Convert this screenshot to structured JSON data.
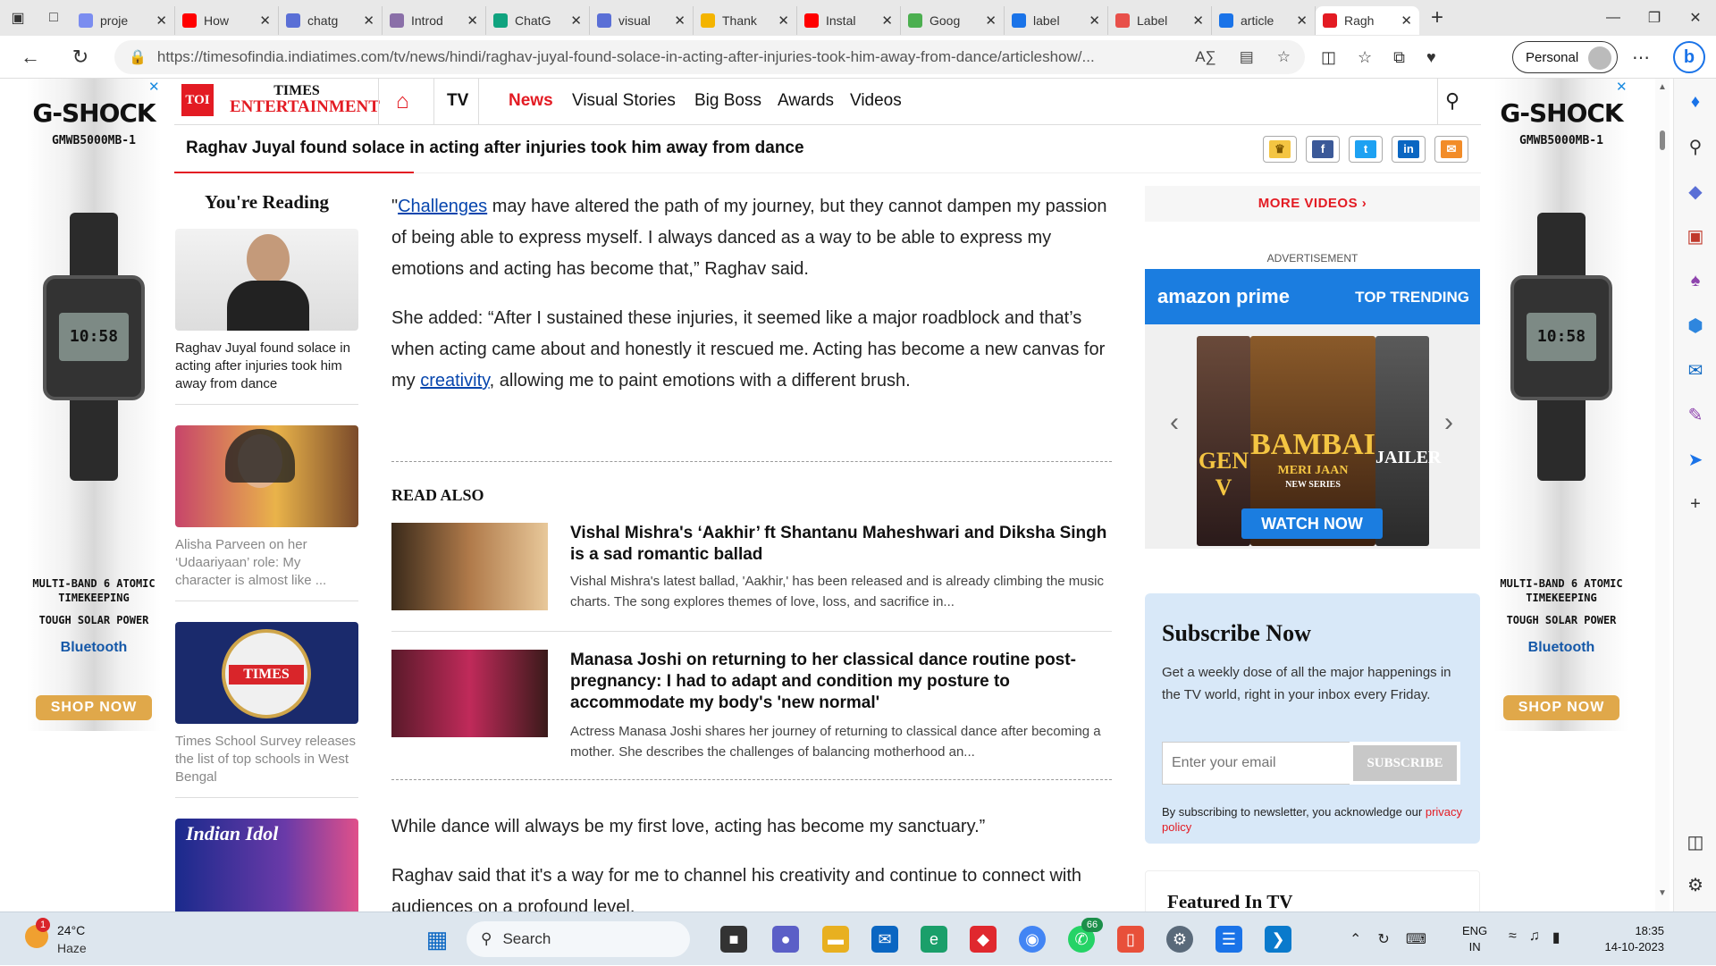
{
  "browser": {
    "tabs": [
      {
        "label": "proje",
        "color": "#7b8df0"
      },
      {
        "label": "How",
        "color": "#ff0000"
      },
      {
        "label": "chatg",
        "color": "#5a6fd6"
      },
      {
        "label": "Introd",
        "color": "#8a6fa8"
      },
      {
        "label": "ChatG",
        "color": "#10a37f"
      },
      {
        "label": "visual",
        "color": "#5a6fd6"
      },
      {
        "label": "Thank",
        "color": "#f4b400"
      },
      {
        "label": "Instal",
        "color": "#ff0000"
      },
      {
        "label": "Goog",
        "color": "#4caf50"
      },
      {
        "label": "label",
        "color": "#1a73e8"
      },
      {
        "label": "Label",
        "color": "#e8504a"
      },
      {
        "label": "article",
        "color": "#1a73e8"
      },
      {
        "label": "Ragh",
        "color": "#e31b23"
      }
    ],
    "url": "https://timesofindia.indiatimes.com/tv/news/hindi/raghav-juyal-found-solace-in-acting-after-injuries-took-him-away-from-dance/articleshow/...",
    "profile_label": "Personal"
  },
  "ads": {
    "brand": "G-SHOCK",
    "model": "GMWB5000MB-1",
    "watch_time": "10:58",
    "feature1": "MULTI-BAND 6 ATOMIC",
    "feature2": "TIMEKEEPING",
    "feature3": "TOUGH SOLAR POWER",
    "bluetooth": "Bluetooth",
    "cta": "SHOP NOW"
  },
  "header": {
    "toi": "TOI",
    "times": "TIMES",
    "entertainment": "ENTERTAINMENT",
    "section": "TV",
    "menu": [
      "News",
      "Visual Stories",
      "Big Boss",
      "Awards",
      "Videos"
    ],
    "headline": "Raghav Juyal found solace in acting after injuries took him away from dance"
  },
  "left_rail": {
    "title": "You're Reading",
    "items": [
      {
        "caption": "Raghav Juyal found solace in acting after injuries took him away from dance"
      },
      {
        "caption": "Alisha Parveen on her ‘Udaariyaan’ role: My character is almost like ..."
      },
      {
        "caption": "Times School Survey releases the list of top schools in West Bengal",
        "badge": "TIMES"
      },
      {
        "caption": "",
        "badge": "Indian Idol"
      }
    ]
  },
  "article": {
    "p1_before": "\"",
    "p1_link": "Challenges",
    "p1_after": " may have altered the path of my journey, but they cannot dampen my passion of being able to express myself. I always danced as a way to be able to express my emotions and acting has become that,” Raghav said.",
    "p2_before": "She added: “After I sustained these injuries, it seemed like a major roadblock and that’s when acting came about and honestly it rescued me. Acting has become a new canvas for my ",
    "p2_link": "creativity",
    "p2_after": ", allowing me to paint emotions with a different brush.",
    "read_also": "READ ALSO",
    "related": [
      {
        "title": "Vishal Mishra's ‘Aakhir’ ft Shantanu Maheshwari and Diksha Singh is a sad romantic ballad",
        "desc": "Vishal Mishra's latest ballad, 'Aakhir,' has been released and is already climbing the music charts. The song explores themes of love, loss, and sacrifice in..."
      },
      {
        "title": "Manasa Joshi on returning to her classical dance routine post-pregnancy: I had to adapt and condition my posture to accommodate my body's 'new normal'",
        "desc": "Actress Manasa Joshi shares her journey of returning to classical dance after becoming a mother. She describes the challenges of balancing motherhood an..."
      }
    ],
    "p3": "While dance will always be my first love, acting has become my sanctuary.”",
    "p4": "Raghav said that it's a way for me to channel his creativity and continue to connect with audiences on a profound level."
  },
  "right_rail": {
    "more_videos": "MORE VIDEOS",
    "advertisement": "ADVERTISEMENT",
    "prime_brand": "amazon prime",
    "prime_tag": "TOP TRENDING",
    "poster1": "GEN V",
    "poster2": "BAMBAI",
    "poster2b": "MERI JAAN",
    "poster2c": "NEW SERIES",
    "poster3": "JAILER",
    "watch_now": "WATCH NOW",
    "subscribe_title": "Subscribe Now",
    "subscribe_desc": "Get a weekly dose of all the major happenings in the TV world, right in your inbox every Friday.",
    "email_placeholder": "Enter your email",
    "subscribe_btn": "SUBSCRIBE",
    "note_before": "By subscribing to newsletter, you acknowledge our ",
    "note_link": "privacy policy",
    "featured_title": "Featured In TV"
  },
  "taskbar": {
    "temp": "24°C",
    "condition": "Haze",
    "weather_badge": "1",
    "search_label": "Search",
    "whatsapp_badge": "66",
    "lang1": "ENG",
    "lang2": "IN",
    "time": "18:35",
    "date": "14-10-2023"
  },
  "colors": {
    "accent": "#e31b23",
    "link": "#0645ad",
    "subscribe_bg": "#d8e8f8"
  }
}
